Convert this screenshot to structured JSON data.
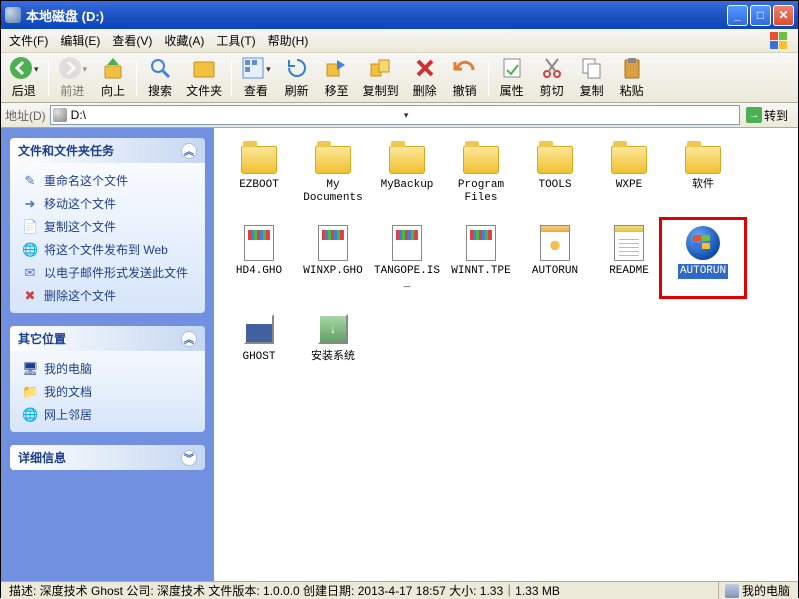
{
  "window": {
    "title": "本地磁盘 (D:)"
  },
  "menu": {
    "file": "文件(F)",
    "edit": "编辑(E)",
    "view": "查看(V)",
    "favorites": "收藏(A)",
    "tools": "工具(T)",
    "help": "帮助(H)"
  },
  "toolbar": {
    "back": "后退",
    "forward": "前进",
    "up": "向上",
    "search": "搜索",
    "folders": "文件夹",
    "view": "查看",
    "refresh": "刷新",
    "move": "移至",
    "copy_to": "复制到",
    "delete": "删除",
    "undo": "撤销",
    "properties": "属性",
    "cut": "剪切",
    "copy": "复制",
    "paste": "粘贴"
  },
  "address": {
    "label": "地址(D)",
    "value": "D:\\",
    "go": "转到"
  },
  "sidebar": {
    "tasks": {
      "title": "文件和文件夹任务",
      "items": [
        "重命名这个文件",
        "移动这个文件",
        "复制这个文件",
        "将这个文件发布到 Web",
        "以电子邮件形式发送此文件",
        "删除这个文件"
      ]
    },
    "places": {
      "title": "其它位置",
      "items": [
        "我的电脑",
        "我的文档",
        "网上邻居"
      ]
    },
    "details": {
      "title": "详细信息"
    }
  },
  "files": [
    {
      "name": "EZBOOT",
      "type": "folder"
    },
    {
      "name": "My Documents",
      "type": "folder"
    },
    {
      "name": "MyBackup",
      "type": "folder"
    },
    {
      "name": "Program Files",
      "type": "folder"
    },
    {
      "name": "TOOLS",
      "type": "folder"
    },
    {
      "name": "WXPE",
      "type": "folder"
    },
    {
      "name": "软件",
      "type": "folder"
    },
    {
      "name": "HD4.GHO",
      "type": "ghost"
    },
    {
      "name": "WINXP.GHO",
      "type": "ghost"
    },
    {
      "name": "TANGOPE.IS_",
      "type": "is"
    },
    {
      "name": "WINNT.TPE",
      "type": "tpe"
    },
    {
      "name": "AUTORUN",
      "type": "inf"
    },
    {
      "name": "README",
      "type": "txt"
    },
    {
      "name": "AUTORUN",
      "type": "exe-win",
      "selected": true,
      "highlighted": true
    },
    {
      "name": "GHOST",
      "type": "exe-ghost"
    },
    {
      "name": "安装系统",
      "type": "exe-install"
    }
  ],
  "status": {
    "description": "描述: 深度技术 Ghost 公司: 深度技术 文件版本: 1.0.0.0 创建日期: 2013-4-17 18:57 大小: 1.33｜1.33 MB",
    "location": "我的电脑"
  }
}
